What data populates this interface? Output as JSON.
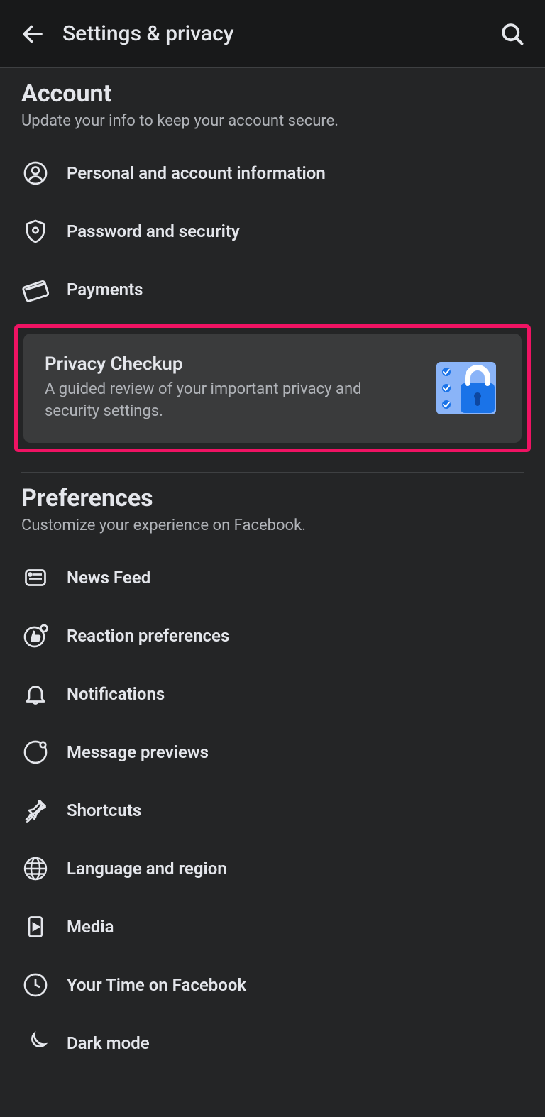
{
  "header": {
    "title": "Settings & privacy"
  },
  "account": {
    "title": "Account",
    "subtitle": "Update your info to keep your account secure.",
    "items": [
      {
        "label": "Personal and account information"
      },
      {
        "label": "Password and security"
      },
      {
        "label": "Payments"
      }
    ]
  },
  "privacy_checkup": {
    "title": "Privacy Checkup",
    "subtitle": "A guided review of your important privacy and security settings."
  },
  "preferences": {
    "title": "Preferences",
    "subtitle": "Customize your experience on Facebook.",
    "items": [
      {
        "label": "News Feed"
      },
      {
        "label": "Reaction preferences"
      },
      {
        "label": "Notifications"
      },
      {
        "label": "Message previews"
      },
      {
        "label": "Shortcuts"
      },
      {
        "label": "Language and region"
      },
      {
        "label": "Media"
      },
      {
        "label": "Your Time on Facebook"
      },
      {
        "label": "Dark mode"
      }
    ]
  }
}
